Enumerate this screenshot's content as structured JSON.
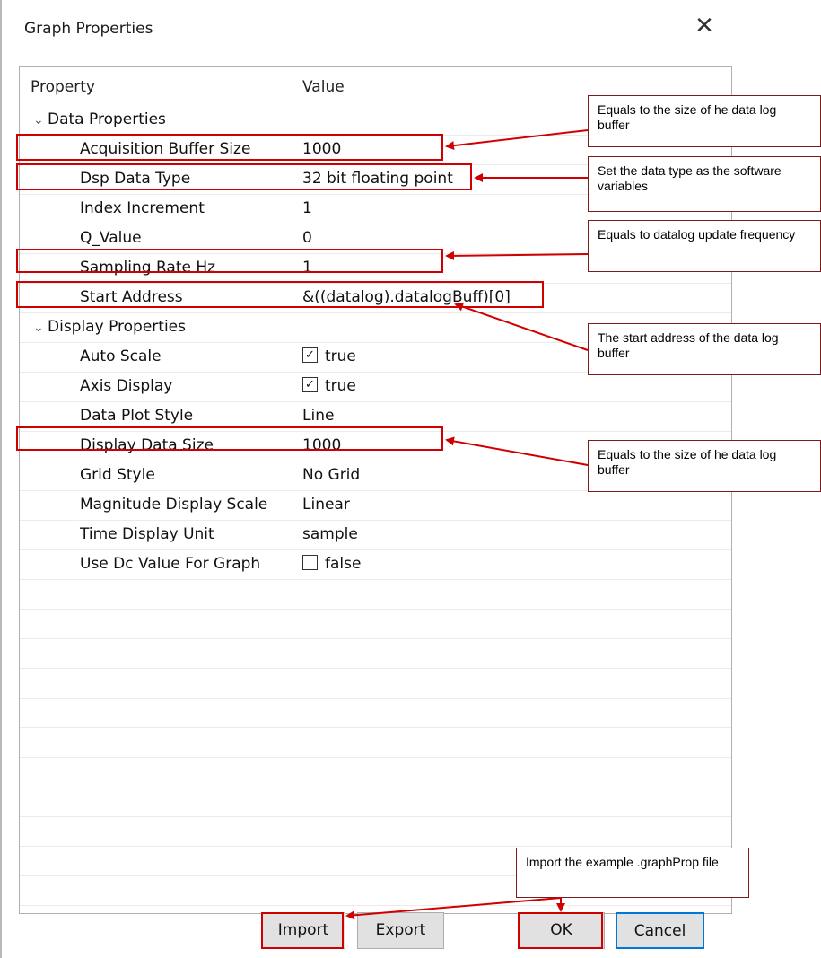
{
  "dialog": {
    "title": "Graph Properties",
    "close_glyph": "✕"
  },
  "table": {
    "header_property": "Property",
    "header_value": "Value",
    "data_properties": {
      "label": "Data Properties",
      "items": [
        {
          "name": "Acquisition Buffer Size",
          "value": "1000"
        },
        {
          "name": "Dsp Data Type",
          "value": "32 bit floating point"
        },
        {
          "name": "Index Increment",
          "value": "1"
        },
        {
          "name": "Q_Value",
          "value": "0"
        },
        {
          "name": "Sampling Rate Hz",
          "value": "1"
        },
        {
          "name": "Start Address",
          "value": "&((datalog).datalogBuff)[0]"
        }
      ]
    },
    "display_properties": {
      "label": "Display Properties",
      "items": [
        {
          "name": "Auto Scale",
          "value": "true",
          "checkbox": true,
          "checked": true
        },
        {
          "name": "Axis Display",
          "value": "true",
          "checkbox": true,
          "checked": true
        },
        {
          "name": "Data Plot Style",
          "value": "Line"
        },
        {
          "name": "Display Data Size",
          "value": "1000"
        },
        {
          "name": "Grid Style",
          "value": "No Grid"
        },
        {
          "name": "Magnitude Display Scale",
          "value": "Linear"
        },
        {
          "name": "Time Display Unit",
          "value": "sample"
        },
        {
          "name": "Use Dc Value For Graph",
          "value": "false",
          "checkbox": true,
          "checked": false
        }
      ]
    }
  },
  "buttons": {
    "import": "Import",
    "export": "Export",
    "ok": "OK",
    "cancel": "Cancel"
  },
  "annotations": {
    "buffer_size": "Equals to the size of he data log buffer",
    "data_type": "Set the data type as the software variables",
    "sampling_rate": "Equals to datalog update frequency",
    "start_address": "The start address of the data log buffer",
    "display_size": "Equals to the size of he data log buffer",
    "import_hint": "Import the example .graphProp file"
  },
  "colors": {
    "annotation_red": "#d00000",
    "focus_blue": "#0078d7",
    "button_gray": "#e1e1e1"
  }
}
